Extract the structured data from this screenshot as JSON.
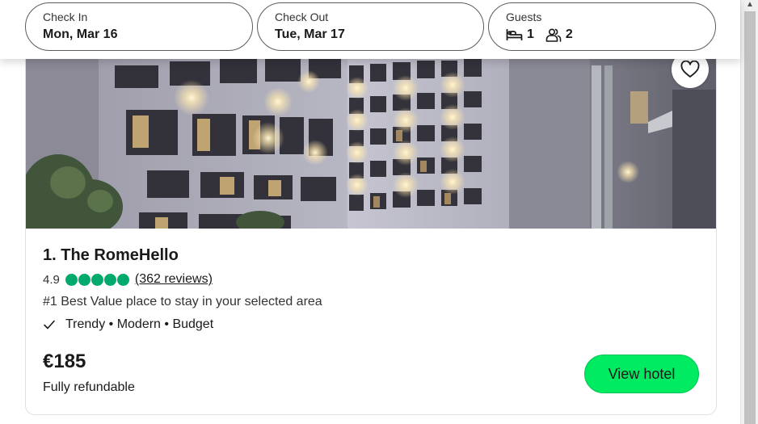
{
  "search": {
    "checkin_label": "Check In",
    "checkin_value": "Mon, Mar 16",
    "checkout_label": "Check Out",
    "checkout_value": "Tue, Mar 17",
    "guests_label": "Guests",
    "rooms_count": "1",
    "adults_count": "2",
    "icons": [
      "bed-icon",
      "people-icon"
    ]
  },
  "hotel": {
    "name": "1. The RomeHello",
    "rating": "4.9",
    "rating_bubbles": 5,
    "reviews": "(362 reviews)",
    "rank": "#1 Best Value place to stay in your selected area",
    "tags": "Trendy • Modern • Budget",
    "price": "€185",
    "refund": "Fully refundable",
    "view_button": "View hotel",
    "favorite_icon": "heart-icon"
  },
  "colors": {
    "accent_green": "#00ea62",
    "bubble_green": "#00aa6c",
    "text_dark": "#1a1a1a"
  }
}
